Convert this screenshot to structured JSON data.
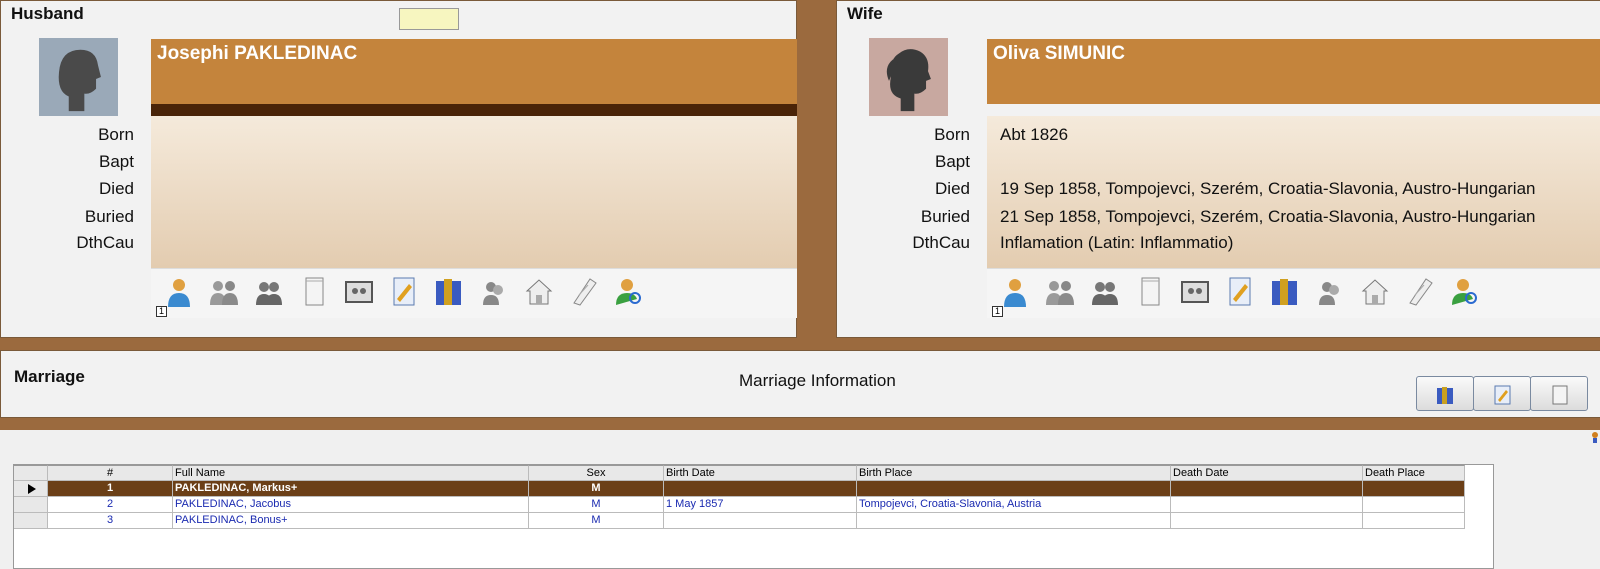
{
  "husband": {
    "panel_title": "Husband",
    "name": "Josephi PAKLEDINAC",
    "photo_icon": "male-silhouette-icon",
    "events": [
      {
        "label": "Born",
        "value": ""
      },
      {
        "label": "Bapt",
        "value": ""
      },
      {
        "label": "Died",
        "value": ""
      },
      {
        "label": "Buried",
        "value": ""
      },
      {
        "label": "DthCau",
        "value": ""
      }
    ],
    "badge": "1"
  },
  "wife": {
    "panel_title": "Wife",
    "name": "Oliva SIMUNIC",
    "photo_icon": "female-silhouette-icon",
    "events": [
      {
        "label": "Born",
        "value": "Abt 1826"
      },
      {
        "label": "Bapt",
        "value": ""
      },
      {
        "label": "Died",
        "value": "19 Sep 1858, Tompojevci, Szerém, Croatia-Slavonia, Austro-Hungarian"
      },
      {
        "label": "Buried",
        "value": "21 Sep 1858, Tompojevci, Szerém, Croatia-Slavonia, Austro-Hungarian"
      },
      {
        "label": "DthCau",
        "value": "Inflamation (Latin: Inflammatio)"
      }
    ],
    "badge": "1"
  },
  "toolbar_icons": [
    "person-icon",
    "parents-icon",
    "spouses-icon",
    "notes-icon",
    "media-icon",
    "edit-notes-icon",
    "sources-icon",
    "associates-icon",
    "address-icon",
    "tasks-icon",
    "search-person-icon"
  ],
  "marriage": {
    "panel_title": "Marriage",
    "info_label": "Marriage Information",
    "buttons": [
      "sources-icon",
      "edit-notes-icon",
      "notes-icon"
    ]
  },
  "children": {
    "columns": [
      "#",
      "Full Name",
      "Sex",
      "Birth Date",
      "Birth Place",
      "Death Date",
      "Death Place"
    ],
    "rows": [
      {
        "num": "1",
        "name": "PAKLEDINAC, Markus+",
        "sex": "M",
        "birth_date": "",
        "birth_place": "",
        "death_date": "",
        "death_place": "",
        "selected": true
      },
      {
        "num": "2",
        "name": "PAKLEDINAC, Jacobus",
        "sex": "M",
        "birth_date": "1 May 1857",
        "birth_place": "Tompojevci, Croatia-Slavonia, Austria",
        "death_date": "",
        "death_place": "",
        "selected": false
      },
      {
        "num": "3",
        "name": "PAKLEDINAC, Bonus+",
        "sex": "M",
        "birth_date": "",
        "birth_place": "",
        "death_date": "",
        "death_place": "",
        "selected": false
      }
    ]
  },
  "colors": {
    "header_orange": "#c4843c",
    "dark_band": "#4a2408",
    "selected_row": "#6b3f17",
    "frame_brown": "#9b6a3e",
    "link_blue": "#1a2ab0",
    "male_photo_bg": "#9aa9b8",
    "female_photo_bg": "#c8a8a0"
  }
}
